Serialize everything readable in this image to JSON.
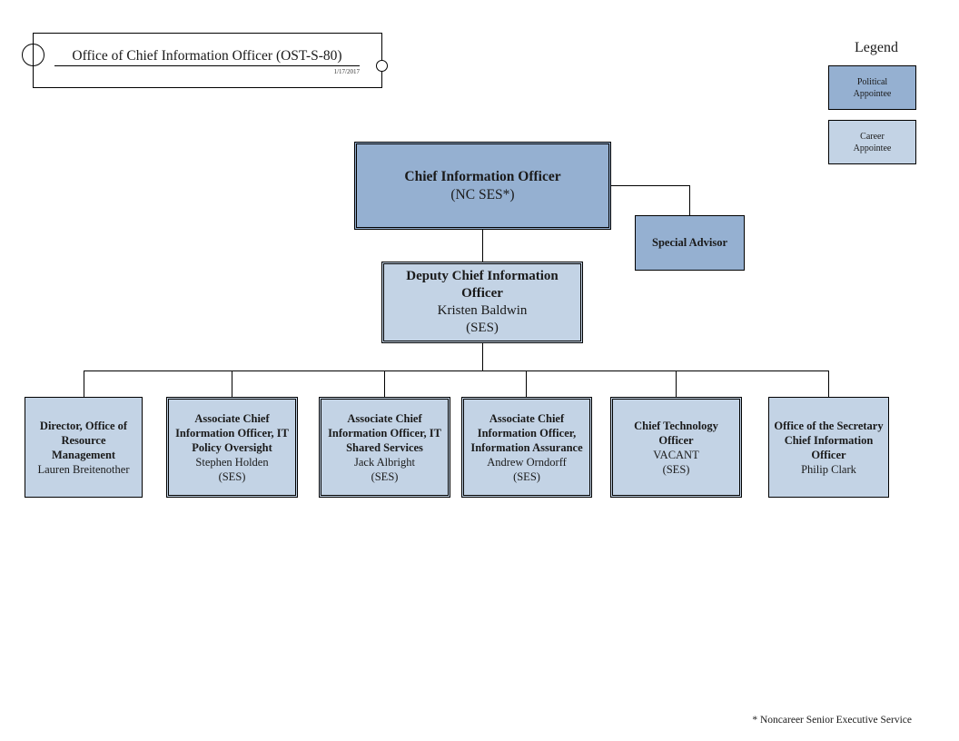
{
  "header": {
    "title": "Office of Chief Information Officer (OST-S-80)",
    "date": "1/17/2017"
  },
  "legend": {
    "title": "Legend",
    "items": [
      {
        "label_line1": "Political",
        "label_line2": "Appointee",
        "color": "#95b0d1"
      },
      {
        "label_line1": "Career",
        "label_line2": "Appointee",
        "color": "#c3d3e5"
      }
    ]
  },
  "nodes": {
    "cio": {
      "title": "Chief Information Officer",
      "grade": "(NC SES*)",
      "type": "political"
    },
    "special_advisor": {
      "title": "Special Advisor",
      "type": "political"
    },
    "deputy": {
      "title_line1": "Deputy Chief Information",
      "title_line2": "Officer",
      "name": "Kristen Baldwin",
      "grade": "(SES)",
      "type": "career"
    },
    "reports": [
      {
        "title_lines": [
          "Director, Office of",
          "Resource",
          "Management"
        ],
        "name": "Lauren Breitenother",
        "grade": "",
        "type": "career"
      },
      {
        "title_lines": [
          "Associate Chief",
          "Information Officer, IT",
          "Policy Oversight"
        ],
        "name": "Stephen Holden",
        "grade": "(SES)",
        "type": "career"
      },
      {
        "title_lines": [
          "Associate Chief",
          "Information Officer, IT",
          "Shared Services"
        ],
        "name": "Jack Albright",
        "grade": "(SES)",
        "type": "career"
      },
      {
        "title_lines": [
          "Associate Chief",
          "Information Officer,",
          "Information Assurance"
        ],
        "name": "Andrew Orndorff",
        "grade": "(SES)",
        "type": "career"
      },
      {
        "title_lines": [
          "Chief Technology",
          "Officer"
        ],
        "name": "VACANT",
        "grade": "(SES)",
        "type": "career"
      },
      {
        "title_lines": [
          "Office of the Secretary",
          "Chief Information",
          "Officer"
        ],
        "name": "Philip Clark",
        "grade": "",
        "type": "career"
      }
    ]
  },
  "footnote": "* Noncareer Senior Executive Service"
}
